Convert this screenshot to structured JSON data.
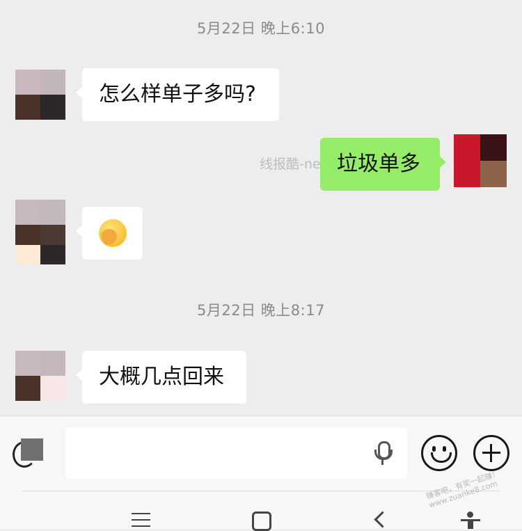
{
  "messages": [
    {
      "type": "timestamp",
      "text": "5月22日 晚上6:10"
    },
    {
      "type": "incoming",
      "text": "怎么样单子多吗?"
    },
    {
      "type": "outgoing",
      "text": "垃圾单多"
    },
    {
      "type": "incoming",
      "icon": "facepalm-emoji"
    },
    {
      "type": "timestamp",
      "text": "5月22日 晚上8:17"
    },
    {
      "type": "incoming",
      "text": "大概几点回来"
    }
  ],
  "watermark": {
    "text": "线报酷-new"
  },
  "corner_watermark": {
    "line1": "赚客吧，有奖一起赚！",
    "line2": "www.zuanke8.com"
  },
  "input_bar": {
    "value": "",
    "icons": [
      "voice-icon",
      "mic-icon",
      "emoji-icon",
      "plus-icon"
    ]
  },
  "nav_bar": {
    "icons": [
      "menu-icon",
      "home-icon",
      "back-icon",
      "accessibility-icon"
    ]
  },
  "colors": {
    "background": "#ededed",
    "incoming_bubble": "#ffffff",
    "outgoing_bubble": "#95ec69"
  }
}
